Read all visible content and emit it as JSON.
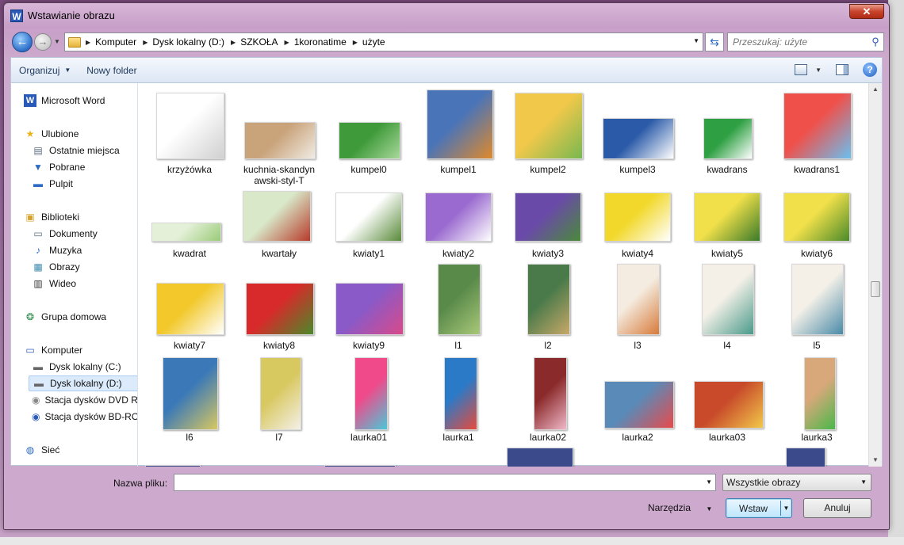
{
  "window": {
    "title": "Wstawianie obrazu",
    "app_icon_letter": "W",
    "close_glyph": "✕"
  },
  "address": {
    "crumbs": [
      "Komputer",
      "Dysk lokalny (D:)",
      "SZKOŁA",
      "1koronatime",
      "użyte"
    ],
    "search_placeholder": "Przeszukaj: użyte"
  },
  "toolbar": {
    "organize_label": "Organizuj",
    "new_folder_label": "Nowy folder"
  },
  "nav": {
    "items": [
      {
        "label": "Microsoft Word",
        "icon": "word-icon"
      },
      {
        "label": "Ulubione",
        "icon": "star-icon"
      },
      {
        "label": "Ostatnie miejsca",
        "icon": "recent-places-icon"
      },
      {
        "label": "Pobrane",
        "icon": "downloads-icon"
      },
      {
        "label": "Pulpit",
        "icon": "desktop-icon"
      },
      {
        "label": "Biblioteki",
        "icon": "libraries-icon"
      },
      {
        "label": "Dokumenty",
        "icon": "documents-icon"
      },
      {
        "label": "Muzyka",
        "icon": "music-icon"
      },
      {
        "label": "Obrazy",
        "icon": "pictures-icon"
      },
      {
        "label": "Wideo",
        "icon": "video-icon"
      },
      {
        "label": "Grupa domowa",
        "icon": "homegroup-icon"
      },
      {
        "label": "Komputer",
        "icon": "computer-icon"
      },
      {
        "label": "Dysk lokalny (C:)",
        "icon": "drive-c-icon"
      },
      {
        "label": "Dysk lokalny (D:)",
        "icon": "drive-d-icon"
      },
      {
        "label": "Stacja dysków DVD RW",
        "icon": "dvd-drive-icon"
      },
      {
        "label": "Stacja dysków BD-ROM",
        "icon": "bd-drive-icon"
      },
      {
        "label": "Sieć",
        "icon": "network-icon"
      }
    ]
  },
  "files": [
    {
      "name": "krzyżówka",
      "colors": [
        "#ffffff",
        "#d0d0d0"
      ]
    },
    {
      "name": "kuchnia-skandynawski-styl-T",
      "colors": [
        "#c9a37a",
        "#f0ece4"
      ]
    },
    {
      "name": "kumpel0",
      "colors": [
        "#3f9a3a",
        "#a8d89a"
      ]
    },
    {
      "name": "kumpel1",
      "colors": [
        "#4a74b8",
        "#e08a2a"
      ]
    },
    {
      "name": "kumpel2",
      "colors": [
        "#f2c84a",
        "#78b850"
      ]
    },
    {
      "name": "kumpel3",
      "colors": [
        "#2a5aa8",
        "#ffffff"
      ]
    },
    {
      "name": "kwadrans",
      "colors": [
        "#2ea043",
        "#ffffff"
      ]
    },
    {
      "name": "kwadrans1",
      "colors": [
        "#f0504a",
        "#6ac0f0"
      ]
    },
    {
      "name": "kwadrat",
      "colors": [
        "#e4f0d8",
        "#9acb78"
      ]
    },
    {
      "name": "kwartały",
      "colors": [
        "#d8e8c8",
        "#b83a2a"
      ]
    },
    {
      "name": "kwiaty1",
      "colors": [
        "#ffffff",
        "#5a8a3a"
      ]
    },
    {
      "name": "kwiaty2",
      "colors": [
        "#9a6ad0",
        "#ffffff"
      ]
    },
    {
      "name": "kwiaty3",
      "colors": [
        "#6a4aa8",
        "#4a8a3a"
      ]
    },
    {
      "name": "kwiaty4",
      "colors": [
        "#f2d82a",
        "#ffffff"
      ]
    },
    {
      "name": "kwiaty5",
      "colors": [
        "#f2e04a",
        "#3a7a2a"
      ]
    },
    {
      "name": "kwiaty6",
      "colors": [
        "#f2e04a",
        "#4a8a2a"
      ]
    },
    {
      "name": "kwiaty7",
      "colors": [
        "#f2c82a",
        "#ffffff"
      ]
    },
    {
      "name": "kwiaty8",
      "colors": [
        "#d82a2a",
        "#4a8a2a"
      ]
    },
    {
      "name": "kwiaty9",
      "colors": [
        "#8a5ac8",
        "#d84a8a"
      ]
    },
    {
      "name": "l1",
      "colors": [
        "#5a8a4a",
        "#a8c878"
      ]
    },
    {
      "name": "l2",
      "colors": [
        "#4a7a4a",
        "#c8a868"
      ]
    },
    {
      "name": "l3",
      "colors": [
        "#f4ece0",
        "#d87a3a"
      ]
    },
    {
      "name": "l4",
      "colors": [
        "#f4f0e8",
        "#4a9a8a"
      ]
    },
    {
      "name": "l5",
      "colors": [
        "#f4f0e8",
        "#4a8aa8"
      ]
    },
    {
      "name": "l6",
      "colors": [
        "#3a78b8",
        "#d8c860"
      ]
    },
    {
      "name": "l7",
      "colors": [
        "#d8c860",
        "#f4f0e8"
      ]
    },
    {
      "name": "laurka01",
      "colors": [
        "#f04a8a",
        "#4ac8d8"
      ]
    },
    {
      "name": "laurka1",
      "colors": [
        "#2a7ac8",
        "#e84a3a"
      ]
    },
    {
      "name": "laurka02",
      "colors": [
        "#8a2a2a",
        "#f0b8c8"
      ]
    },
    {
      "name": "laurka2",
      "colors": [
        "#5a8ab8",
        "#e84a4a"
      ]
    },
    {
      "name": "laurka03",
      "colors": [
        "#c84a2a",
        "#f2c84a"
      ]
    },
    {
      "name": "laurka3",
      "colors": [
        "#d8a87a",
        "#4ab84a"
      ]
    }
  ],
  "bottom": {
    "filename_label": "Nazwa pliku:",
    "filename_value": "",
    "filetype_label": "Wszystkie obrazy",
    "tools_label": "Narzędzia",
    "insert_label": "Wstaw",
    "cancel_label": "Anuluj"
  },
  "colors": {
    "accent": "#3c7fb1",
    "selection": "#dcebfc",
    "window_frame": "#c79fc8"
  }
}
